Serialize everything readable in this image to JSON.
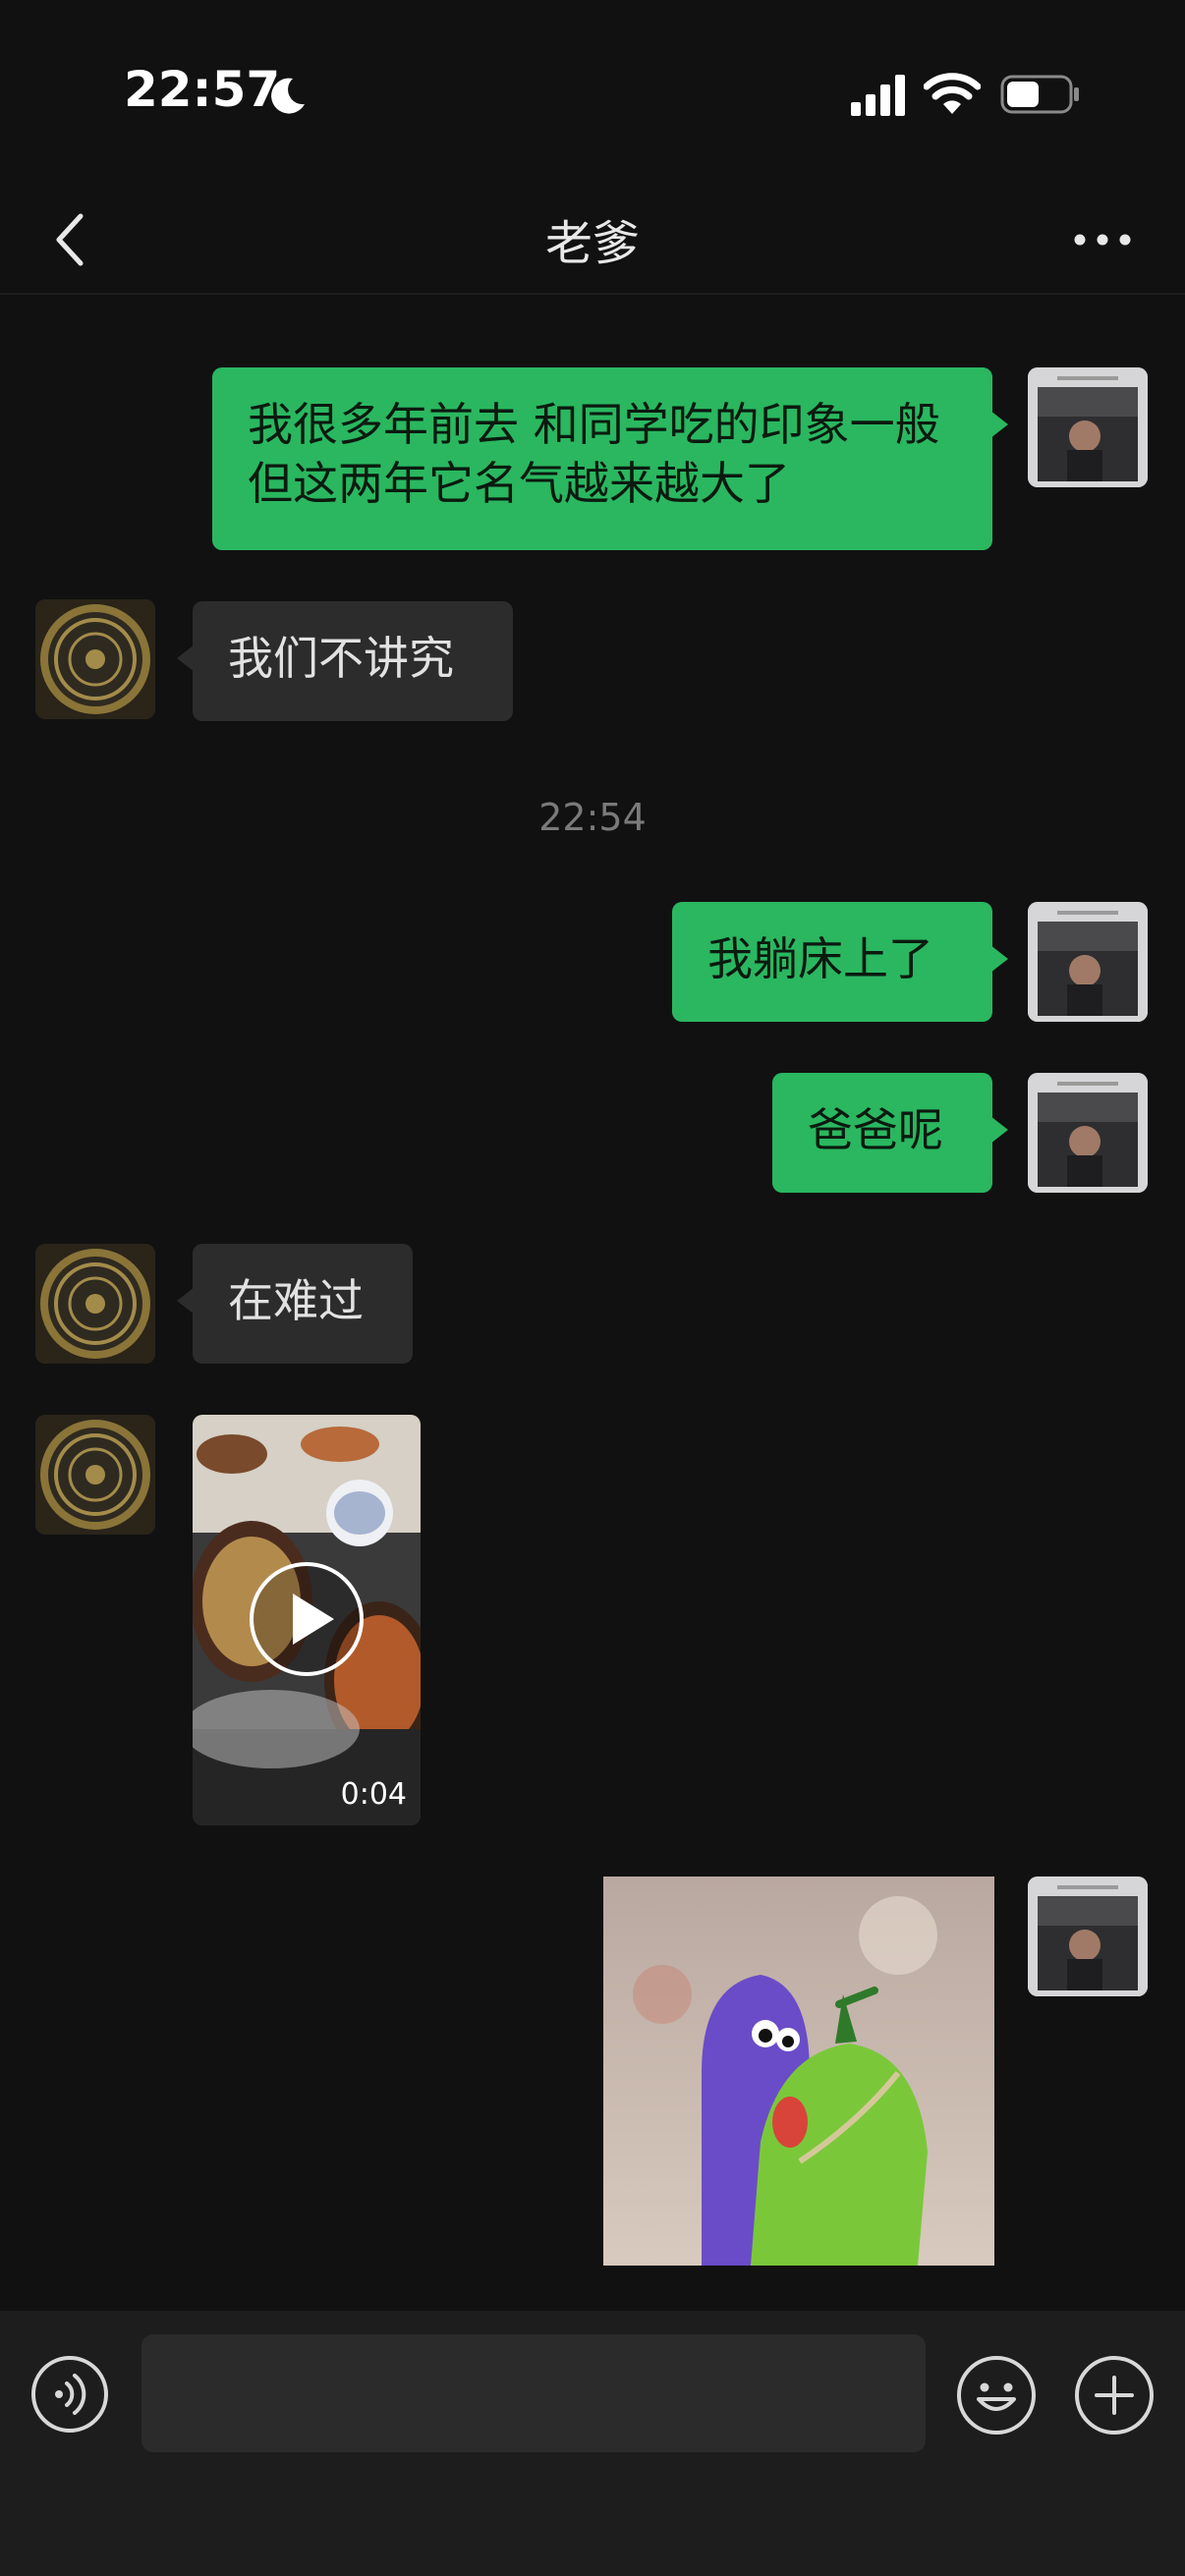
{
  "status_bar": {
    "time": "22:57"
  },
  "nav": {
    "title": "老爹"
  },
  "messages": [
    {
      "sender": "me",
      "text": "我很多年前去 和同学吃的印象一般  但这两年它名气越来越大了"
    },
    {
      "sender": "dad",
      "text": "我们不讲究"
    },
    {
      "type": "timestamp",
      "text": "22:54"
    },
    {
      "sender": "me",
      "text": "我躺床上了"
    },
    {
      "sender": "me",
      "text": "爸爸呢"
    },
    {
      "sender": "dad",
      "text": "在难过"
    },
    {
      "sender": "dad",
      "type": "video",
      "duration": "0:04"
    },
    {
      "sender": "me",
      "type": "sticker",
      "icon": "hugging-plush-sticker"
    }
  ],
  "input_bar": {
    "placeholder": ""
  },
  "colors": {
    "my_bubble": "#2ab760",
    "their_bubble": "#2c2c2c",
    "background": "#111111"
  }
}
